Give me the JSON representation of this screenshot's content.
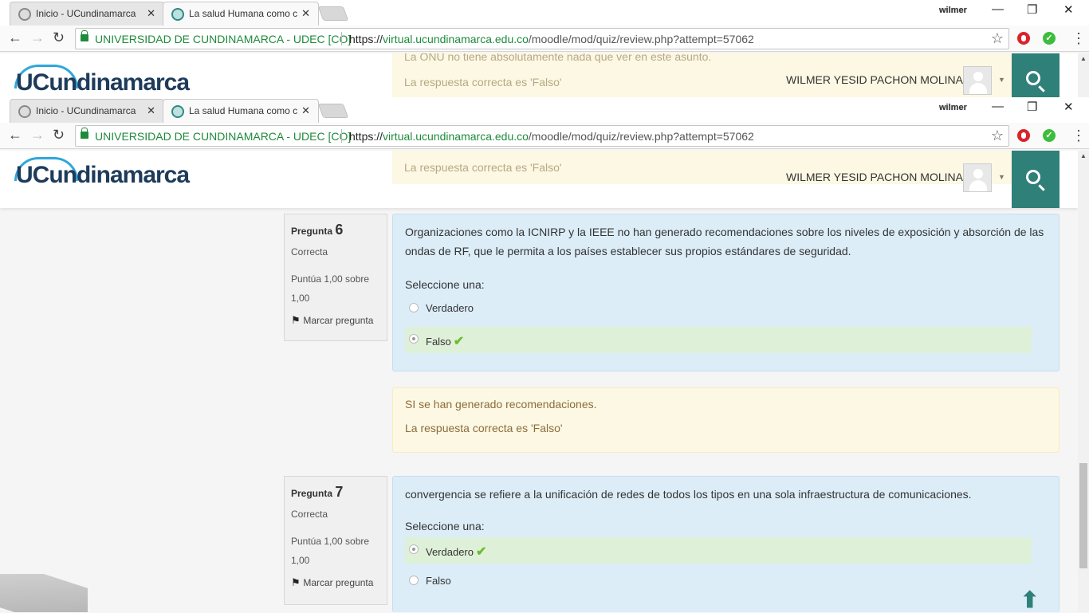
{
  "browser": {
    "tabs": [
      {
        "label": "Inicio - UCundinamarca",
        "close": "✕"
      },
      {
        "label": "La salud Humana como c",
        "close": "✕"
      }
    ],
    "window_user": "wilmer",
    "window_controls": {
      "minimize": "—",
      "restore": "❐",
      "close": "✕"
    },
    "security_label": "UNIVERSIDAD DE CUNDINAMARCA - UDEC [CO]",
    "url_scheme": "https://",
    "url_host": "virtual.ucundinamarca.edu.co",
    "url_path": "/moodle/mod/quiz/review.php?attempt=57062"
  },
  "site": {
    "logo_text": "UCundinamarca",
    "user_name": "WILMER YESID PACHON MOLINA",
    "ghost_feedback_top_1": "La ONU no tiene absolutamente nada que ver en este asunto.",
    "ghost_feedback_top_2": "La respuesta correcta es 'Falso'",
    "ghost_feedback_top_3": "La respuesta correcta es 'Falso'"
  },
  "questions": [
    {
      "label": "Pregunta",
      "number": "6",
      "state": "Correcta",
      "grade": "Puntúa 1,00 sobre 1,00",
      "flag": "Marcar pregunta",
      "text": "Organizaciones como la ICNIRP y la IEEE no han generado recomendaciones sobre los niveles de exposición y absorción de las ondas de RF, que le permita a los países establecer sus propios estándares de seguridad.",
      "prompt": "Seleccione una:",
      "answers": [
        {
          "label": "Verdadero",
          "selected": false,
          "correct": false
        },
        {
          "label": "Falso",
          "selected": true,
          "correct": true
        }
      ],
      "feedback": "SI se han generado recomendaciones.",
      "right_answer": "La respuesta correcta es 'Falso'"
    },
    {
      "label": "Pregunta",
      "number": "7",
      "state": "Correcta",
      "grade": "Puntúa 1,00 sobre 1,00",
      "flag": "Marcar pregunta",
      "text": "convergencia se refiere a la unificación de redes de todos los tipos en una sola infraestructura de comunicaciones.",
      "prompt": "Seleccione una:",
      "answers": [
        {
          "label": "Verdadero",
          "selected": true,
          "correct": true
        },
        {
          "label": "Falso",
          "selected": false,
          "correct": false
        }
      ]
    }
  ],
  "icons": {
    "check": "✔",
    "back_to_top": "⬆"
  },
  "colors": {
    "accent": "#2f8079",
    "question_bg": "#dcedf8",
    "feedback_bg": "#fcf8e3",
    "correct_bg": "#dff0d8",
    "secure_green": "#1e8a3b"
  }
}
